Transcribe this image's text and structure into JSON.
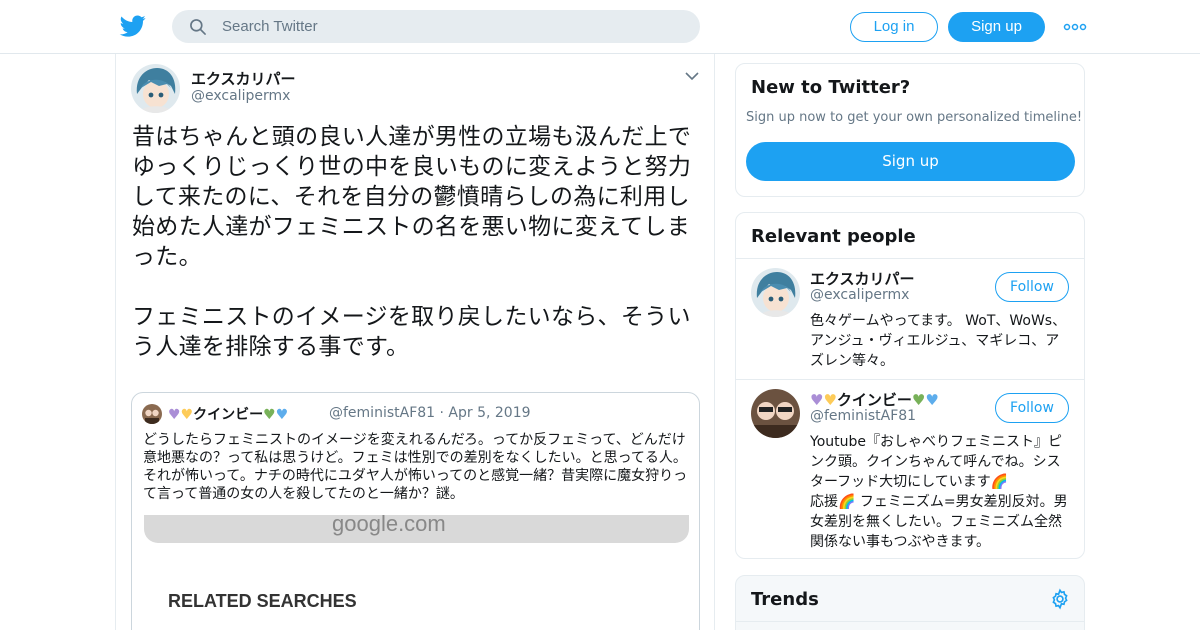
{
  "topbar": {
    "search_placeholder": "Search Twitter",
    "login_label": "Log in",
    "signup_label": "Sign up",
    "more_icon": "more-dots-icon",
    "logo_icon": "twitter-bird-icon"
  },
  "tweet": {
    "author_name": "エクスカリパー",
    "author_handle": "@excalipermx",
    "text": "昔はちゃんと頭の良い人達が男性の立場も汲んだ上でゆっくりじっくり世の中を良いものに変えようと努力して来たのに、それを自分の鬱憤晴らしの為に利用し始めた人達がフェミニストの名を悪い物に変えてしまった。\n\nフェミニストのイメージを取り戻したいなら、そういう人達を排除する事です。",
    "quote": {
      "name_text": "クインビー",
      "handle_date": "@feministAF81 · Apr 5, 2019",
      "text": "どうしたらフェミニストのイメージを変えれるんだろ。ってか反フェミって、どんだけ意地悪なの？って私は思うけど。フェミは性別での差別をなくしたい。と思ってる人。それが怖いって。ナチの時代にユダヤ人が怖いってのと感覚一緒？昔実際に魔女狩りって言って普通の女の人を殺してたのと一緒か？謎。",
      "media_url_text": "google.com",
      "media_title": "RELATED SEARCHES"
    }
  },
  "sidebar": {
    "new_to_twitter": {
      "title": "New to Twitter?",
      "subtitle": "Sign up now to get your own personalized timeline!",
      "button": "Sign up"
    },
    "relevant_people": {
      "title": "Relevant people",
      "people": [
        {
          "name": "エクスカリパー",
          "handle": "@excalipermx",
          "follow": "Follow",
          "bio": "色々ゲームやってます。 WoT、WoWs、アンジュ・ヴィエルジュ、マギレコ、アズレン等々。"
        },
        {
          "name": "クインビー",
          "handle": "@feministAF81",
          "follow": "Follow",
          "bio_1": "Youtube『おしゃべりフェミニスト』ピンク頭。クインちゃんて呼んでね。シスターフッド大切にしています",
          "bio_2": "応援",
          "bio_3": " フェミニズム=男女差別反対。男女差別を無くしたい。フェミニズム全然関係ない事もつぶやきます。"
        }
      ]
    },
    "trends": {
      "title": "Trends",
      "settings_icon": "gear-icon"
    }
  },
  "colors": {
    "brand_blue": "#1da1f2",
    "text_primary": "#14171a",
    "text_secondary": "#657786",
    "border": "#e6ecf0",
    "search_bg": "#e6ecf0"
  }
}
